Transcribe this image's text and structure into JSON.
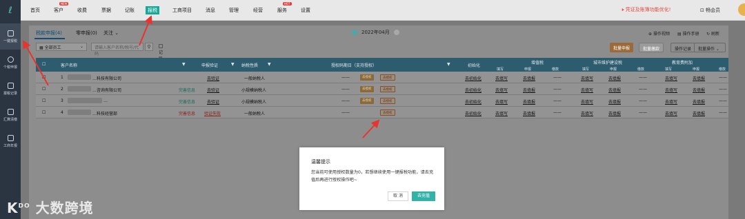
{
  "sidebar": {
    "items": [
      {
        "label": "一键报税",
        "icon": "upload-icon",
        "active": true
      },
      {
        "label": "个税申报",
        "icon": "person-icon",
        "active": false
      },
      {
        "label": "报税记录",
        "icon": "record-icon",
        "active": false
      },
      {
        "label": "汇算清缴",
        "icon": "calculator-icon",
        "active": false
      },
      {
        "label": "工商年报",
        "icon": "calendar-icon",
        "active": false
      }
    ]
  },
  "topnav": {
    "items": [
      {
        "label": "首页"
      },
      {
        "label": "客户",
        "badge": "NEW"
      },
      {
        "label": "收费"
      },
      {
        "label": "票据"
      },
      {
        "label": "记账"
      },
      {
        "label": "报税",
        "active": true
      },
      {
        "label": "工商项目"
      },
      {
        "label": "消息"
      },
      {
        "label": "管理"
      },
      {
        "label": "经营"
      },
      {
        "label": "服务",
        "badge": "HOT"
      },
      {
        "label": "设置"
      }
    ],
    "notice": "凭证及账簿功能优化!",
    "user": "畅会员"
  },
  "tabs": {
    "tab1": "税款申报(4)",
    "tab2": "零申报(0)",
    "tab3": "关注"
  },
  "period": "2022年04月",
  "help": {
    "video": "操作视频",
    "manual": "操作手册",
    "refresh": "刷新"
  },
  "filters": {
    "staff": "全部员工",
    "search_placeholder": "请输入客户名称/税号/代码",
    "checkbox": "记账会计名下账套"
  },
  "actions": {
    "batch_declare": "批量申报",
    "batch_collect": "批量缴款",
    "op_record": "操作记录",
    "batch_op": "批量操作"
  },
  "table": {
    "headers": {
      "customer": "客户名称",
      "verify": "申报验证",
      "taxpayer": "纳税性质",
      "auth": "授权码期日（支持授权）",
      "init": "初始化",
      "vat": "增值税",
      "urban": "城市维护建设税",
      "edu": "教育费附加"
    },
    "subheaders": [
      "填写",
      "申报",
      "缴款"
    ],
    "rows": [
      {
        "no": "1",
        "name": "…科技有限公司",
        "wechat": "",
        "verify": "去验证",
        "taxpayer": "一般纳税人",
        "dash": "——",
        "auth": "去授权",
        "init": "去初始化",
        "fill": "去填写",
        "declare": "去填报",
        "pay": "——"
      },
      {
        "no": "2",
        "name": "…咨询有限公司",
        "wechat": "完善信息",
        "verify": "去验证",
        "taxpayer": "小规模纳税人",
        "dash": "——",
        "auth": "去授权",
        "init": "去初始化",
        "fill": "去填写",
        "declare": "去填报",
        "pay": "——"
      },
      {
        "no": "3",
        "name": "…",
        "wechat": "完善信息",
        "verify": "去验证",
        "taxpayer": "小规模纳税人",
        "dash": "——",
        "auth": "去授权",
        "init": "去初始化",
        "fill": "去填写",
        "declare": "去填报",
        "pay": "——"
      },
      {
        "no": "4",
        "name": "…科技经营部",
        "wechat": "完善信息",
        "verify": "验证失败",
        "taxpayer": "一般纳税人",
        "dash": "——",
        "auth": "去授权",
        "init": "去初始化",
        "fill": "去填写",
        "declare": "去填报",
        "pay": "——"
      }
    ],
    "mini_btn1": "去授权",
    "mini_btn2": "去授权"
  },
  "dialog": {
    "title": "温馨提示",
    "body": "您当前可使用授权数量为0，若想继续使用一键报税功能，请去充值后再进行授权操作吧~",
    "cancel": "取 消",
    "ok": "去充值"
  },
  "watermark": "大数跨境"
}
